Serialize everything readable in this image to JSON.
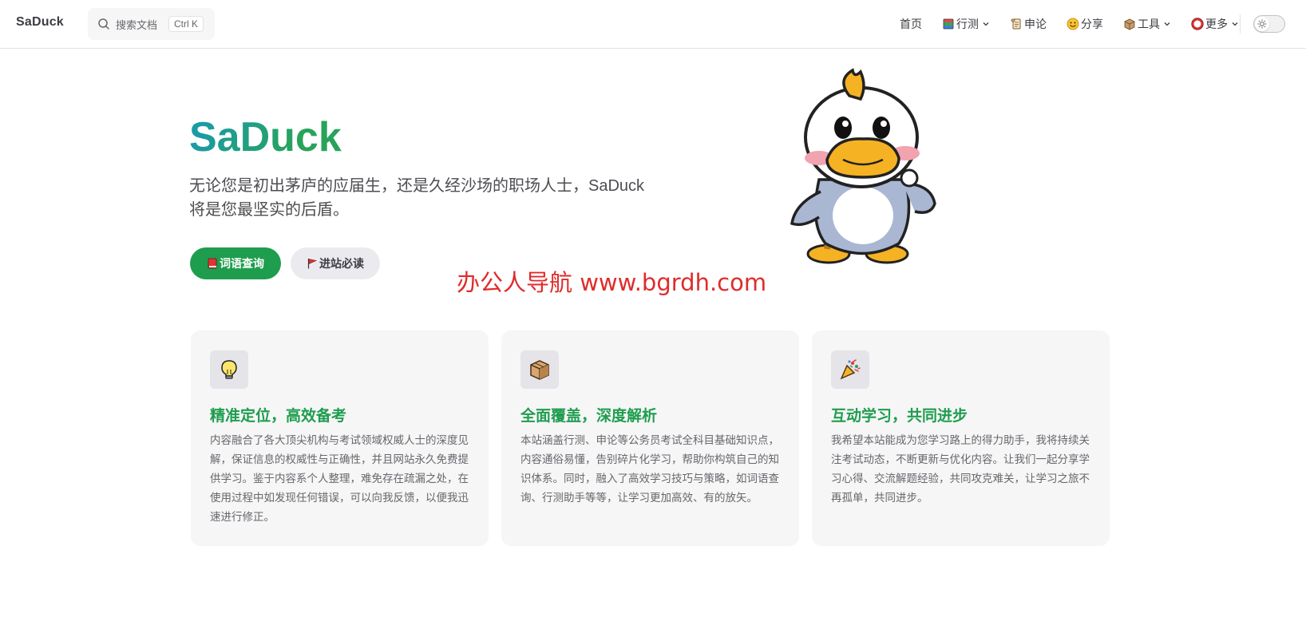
{
  "nav": {
    "brand": "SaDuck",
    "search_placeholder": "搜索文档",
    "search_shortcut": "Ctrl K",
    "items": [
      {
        "label": "首页",
        "icon": "",
        "has_dropdown": false
      },
      {
        "label": "行测",
        "icon": "book-stack-icon",
        "has_dropdown": true
      },
      {
        "label": "申论",
        "icon": "scroll-icon",
        "has_dropdown": false
      },
      {
        "label": "分享",
        "icon": "smiley-icon",
        "has_dropdown": false
      },
      {
        "label": "工具",
        "icon": "box-icon",
        "has_dropdown": true
      },
      {
        "label": "更多",
        "icon": "ring-icon",
        "has_dropdown": true
      }
    ],
    "theme_toggle": "sun-icon"
  },
  "hero": {
    "name": "SaDuck",
    "tagline": "无论您是初出茅庐的应届生，还是久经沙场的职场人士，SaDuck将是您最坚实的后盾。",
    "actions": [
      {
        "label": "词语查询",
        "icon": "red-book-icon",
        "style": "primary"
      },
      {
        "label": "进站必读",
        "icon": "red-flag-icon",
        "style": "alt"
      }
    ]
  },
  "watermark": "办公人导航 www.bgrdh.com",
  "features": [
    {
      "icon": "light-bulb-icon",
      "title": "精准定位，高效备考",
      "desc": "内容融合了各大顶尖机构与考试领域权威人士的深度见解，保证信息的权威性与正确性，并且网站永久免费提供学习。鉴于内容系个人整理，难免存在疏漏之处，在使用过程中如发现任何错误，可以向我反馈，以便我迅速进行修正。"
    },
    {
      "icon": "package-icon",
      "title": "全面覆盖，深度解析",
      "desc": "本站涵盖行测、申论等公务员考试全科目基础知识点，内容通俗易懂，告别碎片化学习，帮助你构筑自己的知识体系。同时，融入了高效学习技巧与策略，如词语查询、行测助手等等，让学习更加高效、有的放矢。"
    },
    {
      "icon": "party-popper-icon",
      "title": "互动学习，共同进步",
      "desc": "我希望本站能成为您学习路上的得力助手，我将持续关注考试动态，不断更新与优化内容。让我们一起分享学习心得、交流解题经验，共同攻克难关，让学习之旅不再孤单，共同进步。"
    }
  ],
  "colors": {
    "brand_green": "#1f9d4e",
    "brand_teal": "#1a9ba8",
    "watermark_red": "#e02b2b"
  }
}
